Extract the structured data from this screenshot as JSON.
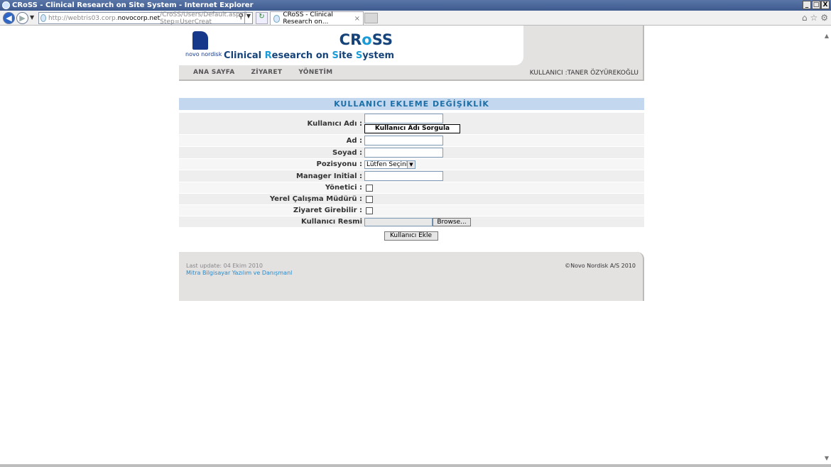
{
  "window": {
    "title": "CRoSS - Clinical Research on Site System - Internet Explorer",
    "controls": [
      "_",
      "□",
      "X"
    ]
  },
  "browser": {
    "url_prefix": "http://webtris03.corp.",
    "url_host": "novocorp.net",
    "url_path": "/CroSS/Users/Default.aspx?Step=UserCreat",
    "tab_title": "CRoSS - Clinical Research on...",
    "tab_close": "×",
    "icons": [
      "back-icon",
      "forward-icon",
      "search-icon",
      "refresh-icon",
      "home-icon",
      "favorites-icon",
      "gear-icon"
    ]
  },
  "header": {
    "logo_text": "novo nordisk",
    "brand_pre": "CR",
    "brand_o": "o",
    "brand_post": "SS",
    "subtitle_a": "Clinical ",
    "subtitle_b": "R",
    "subtitle_c": "esearch on ",
    "subtitle_d": "S",
    "subtitle_e": "ite ",
    "subtitle_f": "S",
    "subtitle_g": "ystem"
  },
  "menu": {
    "items": [
      "ANA SAYFA",
      "ZİYARET",
      "YÖNETİM"
    ],
    "user": "KULLANICI :TANER ÖZYÜREKOĞLU"
  },
  "form": {
    "title": "KULLANICI EKLEME DEĞİŞİKLİK",
    "username_label": "Kullanıcı Adı :",
    "query_button": "Kullanıcı Adı Sorgula",
    "name_label": "Ad :",
    "surname_label": "Soyad :",
    "position_label": "Pozisyonu :",
    "position_selected": "Lütfen Seçiniz",
    "manager_label": "Manager Initial :",
    "admin_label": "Yönetici :",
    "local_manager_label": "Yerel Çalışma Müdürü :",
    "visit_label": "Ziyaret Girebilir :",
    "photo_label": "Kullanıcı Resmi",
    "browse_button": "Browse...",
    "submit_button": "Kullanıcı Ekle"
  },
  "footer": {
    "last_update": "Last update: 04 Ekim 2010",
    "company": "Mitra Bilgisayar Yazılım ve Danışmanl",
    "copyright": "©Novo Nordisk A/S 2010"
  }
}
